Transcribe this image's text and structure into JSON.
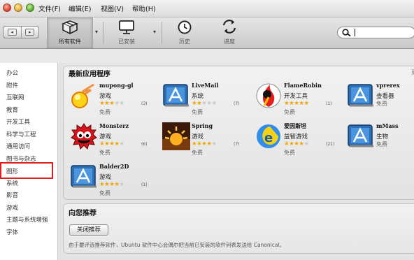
{
  "menubar": {
    "menus": [
      "文件(F)",
      "编辑(E)",
      "视图(V)",
      "帮助(H)"
    ]
  },
  "toolbar": {
    "back_label": "◂",
    "forward_label": "▸",
    "all_software": "所有软件",
    "installed": "已安装",
    "history": "历史",
    "progress": "进度",
    "dropdown_glyph": "▾"
  },
  "sidebar": {
    "categories": [
      "办公",
      "附件",
      "互联网",
      "教育",
      "开发工具",
      "科学与工程",
      "通用访问",
      "图书与杂志",
      "图形",
      "系统",
      "影音",
      "游戏",
      "主题与系统增强",
      "字体"
    ],
    "highlighted": "图形"
  },
  "new_apps": {
    "title": "最新应用程序",
    "more": "更",
    "apps": [
      {
        "name": "mupong-gl",
        "category": "游戏",
        "rating": 3,
        "count": "(3)",
        "price": "免费",
        "icon": "fireball-icon"
      },
      {
        "name": "LiveMail",
        "category": "系统",
        "rating": 2,
        "count": "(7)",
        "price": "免费",
        "icon": "app-store-icon"
      },
      {
        "name": "FlameRobin",
        "category": "开发工具",
        "rating": 5,
        "count": "(1)",
        "price": "免费",
        "icon": "flamerobin-icon"
      },
      {
        "name": "vprerex",
        "category": "查看器",
        "rating": 0,
        "count": "",
        "price": "免费",
        "icon": "app-store-icon"
      },
      {
        "name": "Monsterz",
        "category": "游戏",
        "rating": 4,
        "count": "(6)",
        "price": "免费",
        "icon": "monster-icon"
      },
      {
        "name": "Spring",
        "category": "游戏",
        "rating": 4,
        "count": "(7)",
        "price": "免费",
        "icon": "spring-icon"
      },
      {
        "name": "爱因斯坦",
        "category": "益智游戏",
        "rating": 4,
        "count": "(21)",
        "price": "免费",
        "icon": "einstein-icon"
      },
      {
        "name": "mMass",
        "category": "生物",
        "rating": 0,
        "count": "",
        "price": "免费",
        "icon": "app-store-icon"
      },
      {
        "name": "Balder2D",
        "category": "游戏",
        "rating": 4,
        "count": "(1)",
        "price": "免费",
        "icon": "app-store-icon"
      }
    ]
  },
  "recommendations": {
    "title": "向您推荐",
    "close_button": "关闭推荐",
    "description": "由于要评选推荐软件，Ubuntu 软件中心会偶尔把当前已安装的软件列表发送给 Canonical。"
  },
  "colors": {
    "highlight_border": "#e02020",
    "star": "#f2a400"
  }
}
